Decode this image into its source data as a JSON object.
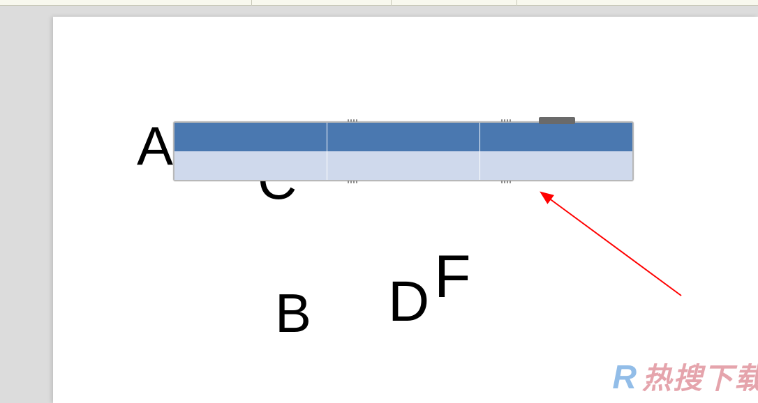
{
  "canvas": {
    "textBoxes": {
      "a": "A",
      "b": "B",
      "c": "C",
      "d": "D",
      "f": "F"
    }
  },
  "table": {
    "rows": 2,
    "cols": 3,
    "header_color": "#4a78b0",
    "body_color": "#cfd9ec"
  },
  "annotation": {
    "arrow_color": "#ff0000"
  },
  "watermark": {
    "prefix": "R",
    "text": "热搜下载"
  }
}
